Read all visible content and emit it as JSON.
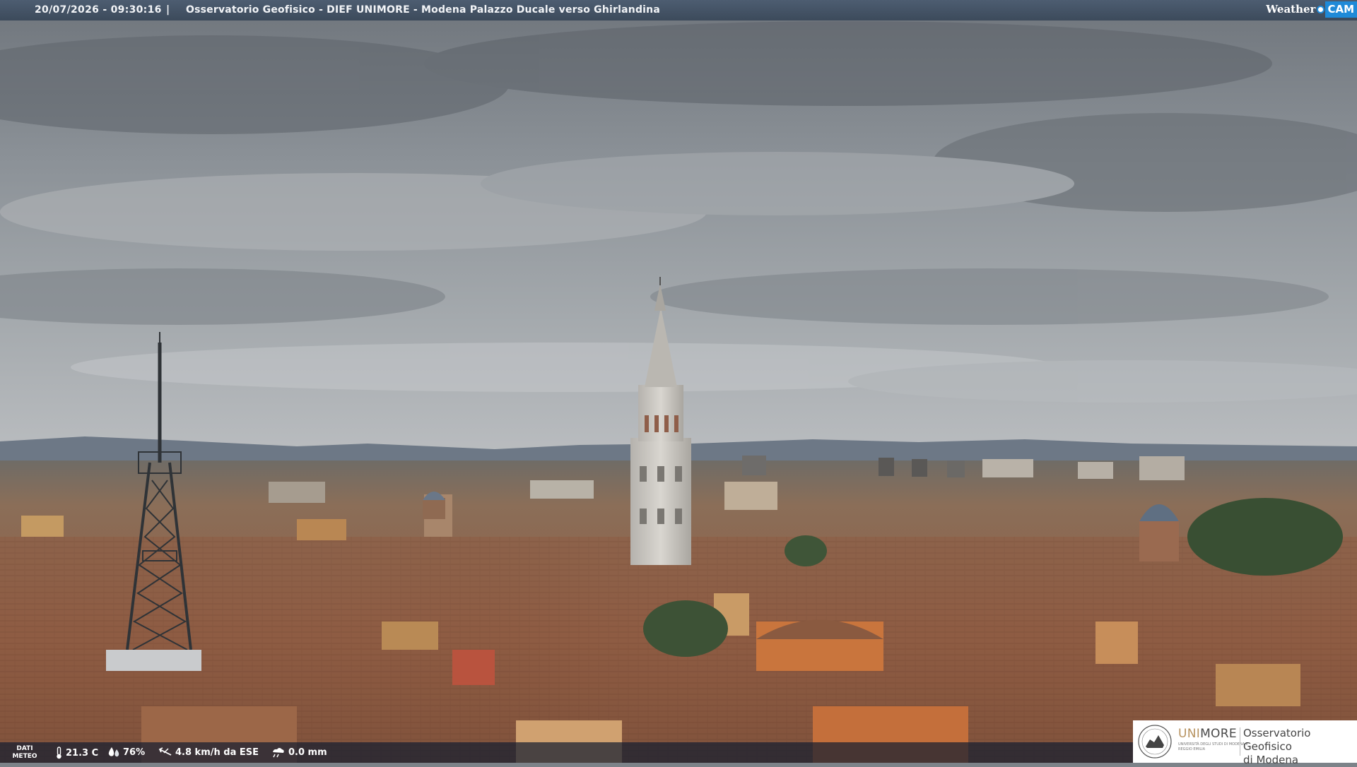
{
  "top_bar": {
    "datetime": "20/07/2026 - 09:30:16",
    "separator": "|",
    "title": "Osservatorio Geofisico - DIEF UNIMORE - Modena Palazzo Ducale verso Ghirlandina"
  },
  "brand": {
    "weather": "Weather",
    "cam": "CAM"
  },
  "meteo": {
    "label_line1": "DATI",
    "label_line2": "METEO",
    "temperature": "21.3 C",
    "humidity": "76%",
    "wind": "4.8 km/h da ESE",
    "rain": "0.0 mm",
    "icons": [
      "thermometer-icon",
      "humidity-drop-icon",
      "wind-icon",
      "rain-icon"
    ]
  },
  "logo": {
    "uni_part1": "UNI",
    "uni_part2": "MORE",
    "subtitle": "UNIVERSITÀ DEGLI STUDI DI MODENA E REGGIO EMILIA",
    "observatory_line1": "Osservatorio Geofisico",
    "observatory_line2": "di Modena"
  },
  "colors": {
    "sky": "#8c9298",
    "roofs": "#8a5a40",
    "tower": "#c9c6c0",
    "brand_blue": "#1f8ad8",
    "logo_gold": "#b7925f"
  }
}
